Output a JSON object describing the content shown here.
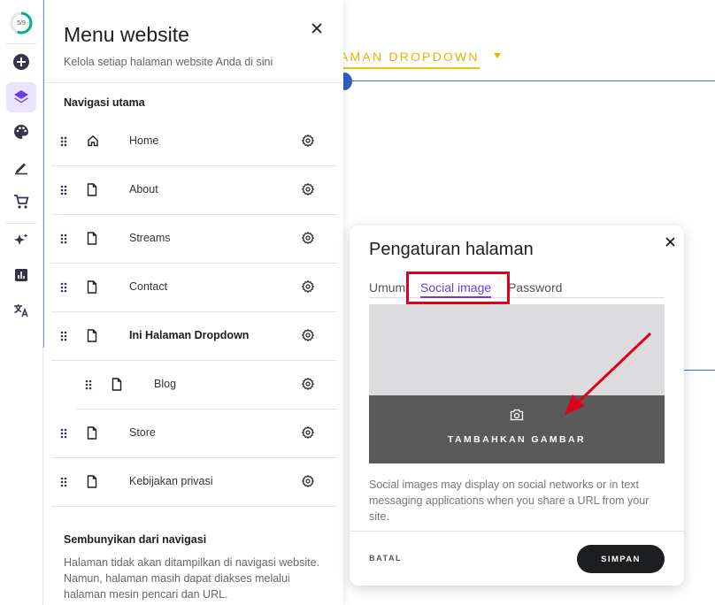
{
  "rail": {
    "progress_text": "5/9",
    "progress_fraction": 0.56,
    "items": [
      {
        "name": "add-icon"
      },
      {
        "name": "layers-icon",
        "active": true
      },
      {
        "name": "palette-icon"
      },
      {
        "name": "pen-icon"
      },
      {
        "name": "cart-icon"
      },
      {
        "name": "sparkle-icon"
      },
      {
        "name": "analytics-icon"
      },
      {
        "name": "translate-icon"
      }
    ]
  },
  "canvas": {
    "dropdown_label": "AMAN DROPDOWN"
  },
  "menu": {
    "title": "Menu website",
    "subtitle": "Kelola setiap halaman website Anda di sini",
    "nav_heading": "Navigasi utama",
    "items": [
      {
        "label": "Home",
        "icon": "home-icon"
      },
      {
        "label": "About",
        "icon": "page-icon"
      },
      {
        "label": "Streams",
        "icon": "page-icon"
      },
      {
        "label": "Contact",
        "icon": "page-icon"
      },
      {
        "label": "Ini Halaman Dropdown",
        "icon": "page-icon",
        "bold": true
      },
      {
        "label": "Blog",
        "icon": "page-icon",
        "child": true
      },
      {
        "label": "Store",
        "icon": "page-icon"
      },
      {
        "label": "Kebijakan privasi",
        "icon": "page-icon"
      }
    ],
    "hidden_heading": "Sembunyikan dari navigasi",
    "hidden_desc": "Halaman tidak akan ditampilkan di navigasi website. Namun, halaman masih dapat diakses melalui halaman mesin pencari dan URL."
  },
  "dialog": {
    "title": "Pengaturan halaman",
    "tabs": [
      {
        "label": "Umum"
      },
      {
        "label": "Social image",
        "active": true
      },
      {
        "label": "Password"
      }
    ],
    "upload_label": "TAMBAHKAN GAMBAR",
    "description": "Social images may display on social networks or in text messaging applications when you share a URL from your site.",
    "cancel_label": "BATAL",
    "save_label": "SIMPAN"
  },
  "colors": {
    "accent": "#673de6",
    "highlight": "#e0001a",
    "dropdown_link": "#e8b400"
  }
}
